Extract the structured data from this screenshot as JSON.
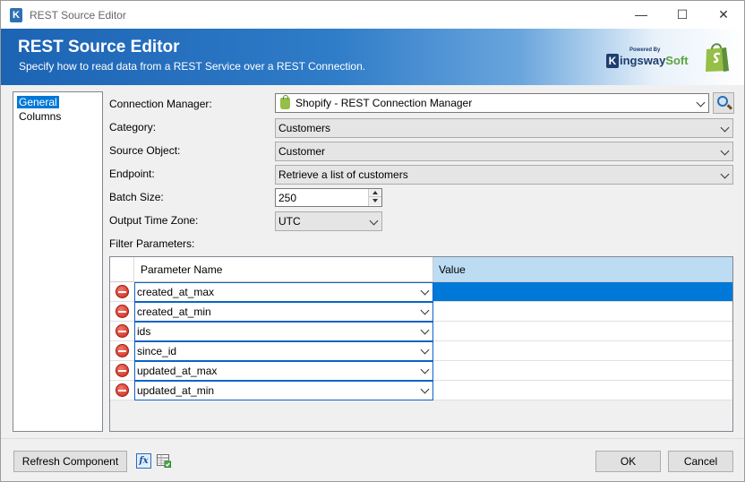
{
  "window": {
    "title": "REST Source Editor",
    "app_icon_letter": "K",
    "minimize": "—",
    "maximize": "☐",
    "close": "✕"
  },
  "header": {
    "title": "REST Source Editor",
    "subtitle": "Specify how to read data from a REST Service over a REST Connection.",
    "brand_powered": "Powered By",
    "brand_letter": "K",
    "brand_name_main": "ingsway",
    "brand_name_soft": "Soft"
  },
  "nav": {
    "items": [
      {
        "label": "General",
        "selected": true
      },
      {
        "label": "Columns",
        "selected": false
      }
    ]
  },
  "form": {
    "connection_manager": {
      "label": "Connection Manager:",
      "value": "Shopify - REST Connection Manager"
    },
    "category": {
      "label": "Category:",
      "value": "Customers"
    },
    "source_object": {
      "label": "Source Object:",
      "value": "Customer"
    },
    "endpoint": {
      "label": "Endpoint:",
      "value": "Retrieve a list of customers"
    },
    "batch_size": {
      "label": "Batch Size:",
      "value": "250"
    },
    "output_time_zone": {
      "label": "Output Time Zone:",
      "value": "UTC"
    },
    "filter_parameters": {
      "label": "Filter Parameters:"
    }
  },
  "grid": {
    "columns": {
      "name": "Parameter Name",
      "value": "Value"
    },
    "rows": [
      {
        "name": "created_at_max",
        "value": "",
        "selected": true
      },
      {
        "name": "created_at_min",
        "value": ""
      },
      {
        "name": "ids",
        "value": ""
      },
      {
        "name": "since_id",
        "value": ""
      },
      {
        "name": "updated_at_max",
        "value": ""
      },
      {
        "name": "updated_at_min",
        "value": ""
      }
    ]
  },
  "footer": {
    "refresh": "Refresh Component",
    "fx": "fx",
    "ok": "OK",
    "cancel": "Cancel"
  },
  "colors": {
    "selection": "#0078d7",
    "header_value_col": "#bcdcf4",
    "banner": "#1c63b4",
    "shopify_green": "#95bf47"
  }
}
